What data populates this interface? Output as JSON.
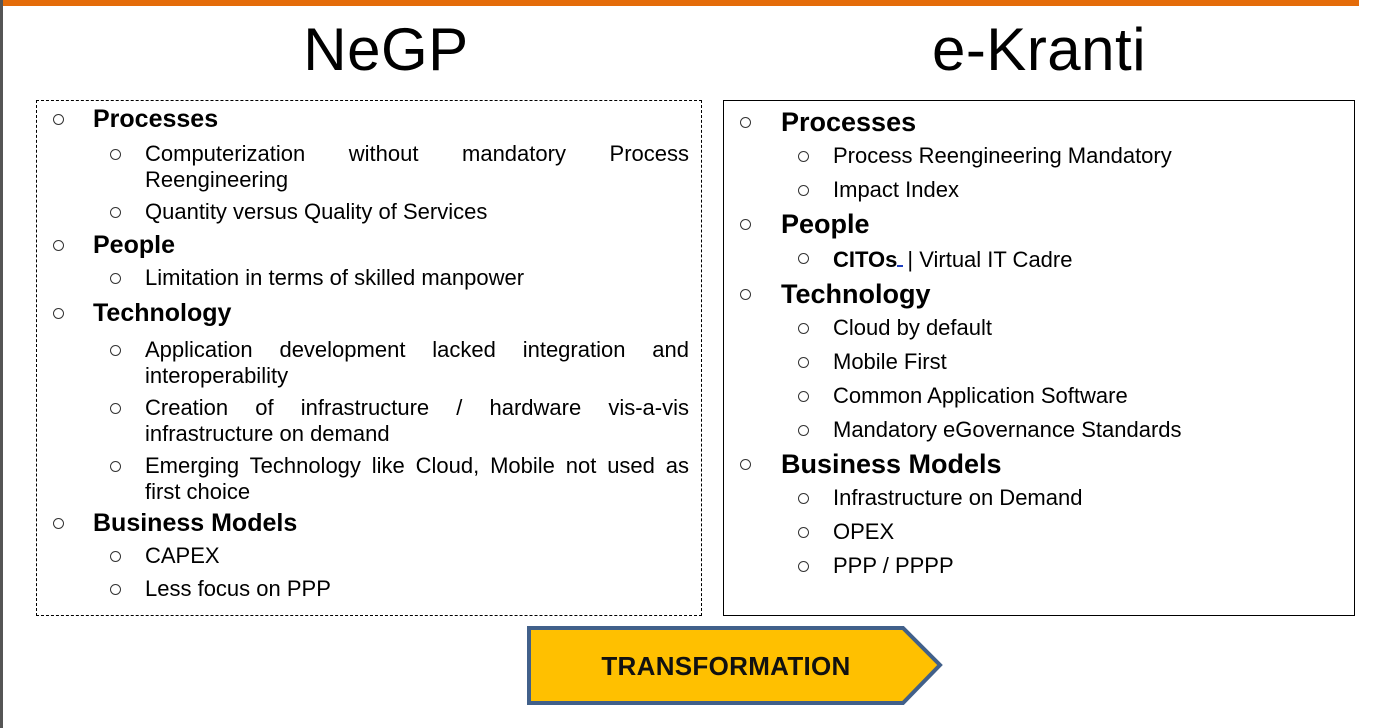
{
  "colors": {
    "top_bar": "#E46C0A",
    "left_bar": "#555555",
    "arrow_fill": "#FFC000",
    "arrow_stroke": "#41608A"
  },
  "left": {
    "title": "NeGP",
    "categories": [
      {
        "label": "Processes",
        "items": [
          "Computerization without mandatory Process Reengineering",
          "Quantity versus Quality of Services"
        ]
      },
      {
        "label": "People",
        "items": [
          "Limitation in terms of skilled manpower"
        ]
      },
      {
        "label": "Technology",
        "items": [
          "Application development lacked integration and interoperability",
          "Creation of infrastructure / hardware vis-a-vis infrastructure on demand",
          "Emerging Technology like Cloud, Mobile not used as first choice"
        ]
      },
      {
        "label": "Business Models",
        "items": [
          "CAPEX",
          "Less focus on PPP"
        ]
      }
    ]
  },
  "right": {
    "title": "e-Kranti",
    "categories": [
      {
        "label": "Processes",
        "items": [
          "Process Reengineering Mandatory",
          "Impact Index"
        ]
      },
      {
        "label": "People",
        "items_bold_prefix": "CITOs",
        "items_rest": "| Virtual IT Cadre"
      },
      {
        "label": "Technology",
        "items": [
          "Cloud by default",
          "Mobile First",
          "Common Application Software",
          "Mandatory eGovernance Standards"
        ]
      },
      {
        "label": "Business Models",
        "items": [
          "Infrastructure on Demand",
          "OPEX",
          "PPP / PPPP"
        ]
      }
    ]
  },
  "arrow": {
    "label": "TRANSFORMATION"
  }
}
